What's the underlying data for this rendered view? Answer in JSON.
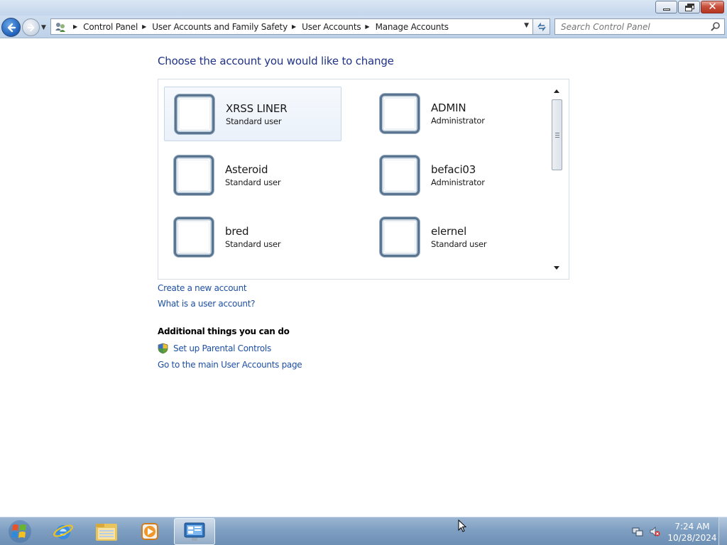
{
  "window": {
    "controls": {
      "minimize": "minimize",
      "restore": "restore",
      "close": "close"
    }
  },
  "nav": {
    "breadcrumbs": [
      "Control Panel",
      "User Accounts and Family Safety",
      "User Accounts",
      "Manage Accounts"
    ],
    "search_placeholder": "Search Control Panel"
  },
  "main": {
    "title": "Choose the account you would like to change",
    "accounts": [
      {
        "name": "XRSS LINER",
        "type": "Standard user",
        "selected": true
      },
      {
        "name": "ADMIN",
        "type": "Administrator",
        "selected": false
      },
      {
        "name": "Asteroid",
        "type": "Standard user",
        "selected": false
      },
      {
        "name": "befaci03",
        "type": "Administrator",
        "selected": false
      },
      {
        "name": "bred",
        "type": "Standard user",
        "selected": false
      },
      {
        "name": "elernel",
        "type": "Standard user",
        "selected": false
      }
    ],
    "links": {
      "create_account": "Create a new account",
      "what_is_account": "What is a user account?"
    },
    "additional": {
      "heading": "Additional things you can do",
      "parental_controls": "Set up Parental Controls",
      "main_page": "Go to the main User Accounts page"
    }
  },
  "taskbar": {
    "items": [
      "start-orb-icon",
      "internet-explorer-icon",
      "windows-explorer-icon",
      "media-player-icon",
      "control-panel-icon"
    ],
    "tray": {
      "time": "7:24 AM",
      "date": "10/28/2024"
    }
  },
  "colors": {
    "link": "#1e4fa2",
    "title": "#1e3287",
    "taskbar": "#7f9fc2"
  }
}
